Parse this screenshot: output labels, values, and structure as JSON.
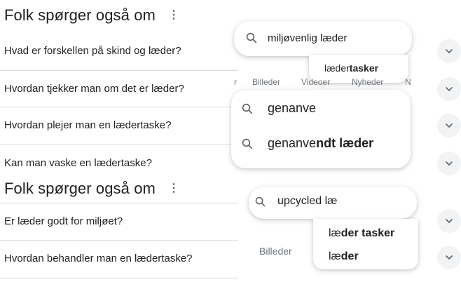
{
  "paa_top": {
    "title": "Folk spørger også om",
    "questions": [
      "Hvad er forskellen på skind og læder?",
      "Hvordan tjekker man om det er læder?",
      "Hvordan plejer man en lædertaske?",
      "Kan man vaske en lædertaske?"
    ]
  },
  "paa_bottom": {
    "title": "Folk spørger også om",
    "questions": [
      "Er læder godt for miljøet?",
      "Hvordan behandler man en lædertaske?"
    ]
  },
  "search1": {
    "query": "miljøvenlig læder",
    "suggestion_prefix": "læder ",
    "suggestion_bold": "tasker"
  },
  "tabs_peek": {
    "items": [
      "r",
      "Billeder",
      "Videoer",
      "Nyheder",
      "N"
    ]
  },
  "search2": {
    "query": "genanve",
    "suggestion_prefix": "genanve",
    "suggestion_bold": "ndt læder"
  },
  "search3": {
    "query": "upcycled læ",
    "suggestions": [
      {
        "prefix": "læ",
        "bold": "der tasker"
      },
      {
        "prefix": "læ",
        "bold": "der"
      }
    ],
    "tab_peek": "Billeder"
  },
  "colors": {
    "text": "#202124",
    "muted": "#5f6368",
    "divider": "#dadce0",
    "chip": "#f1f3f4"
  }
}
